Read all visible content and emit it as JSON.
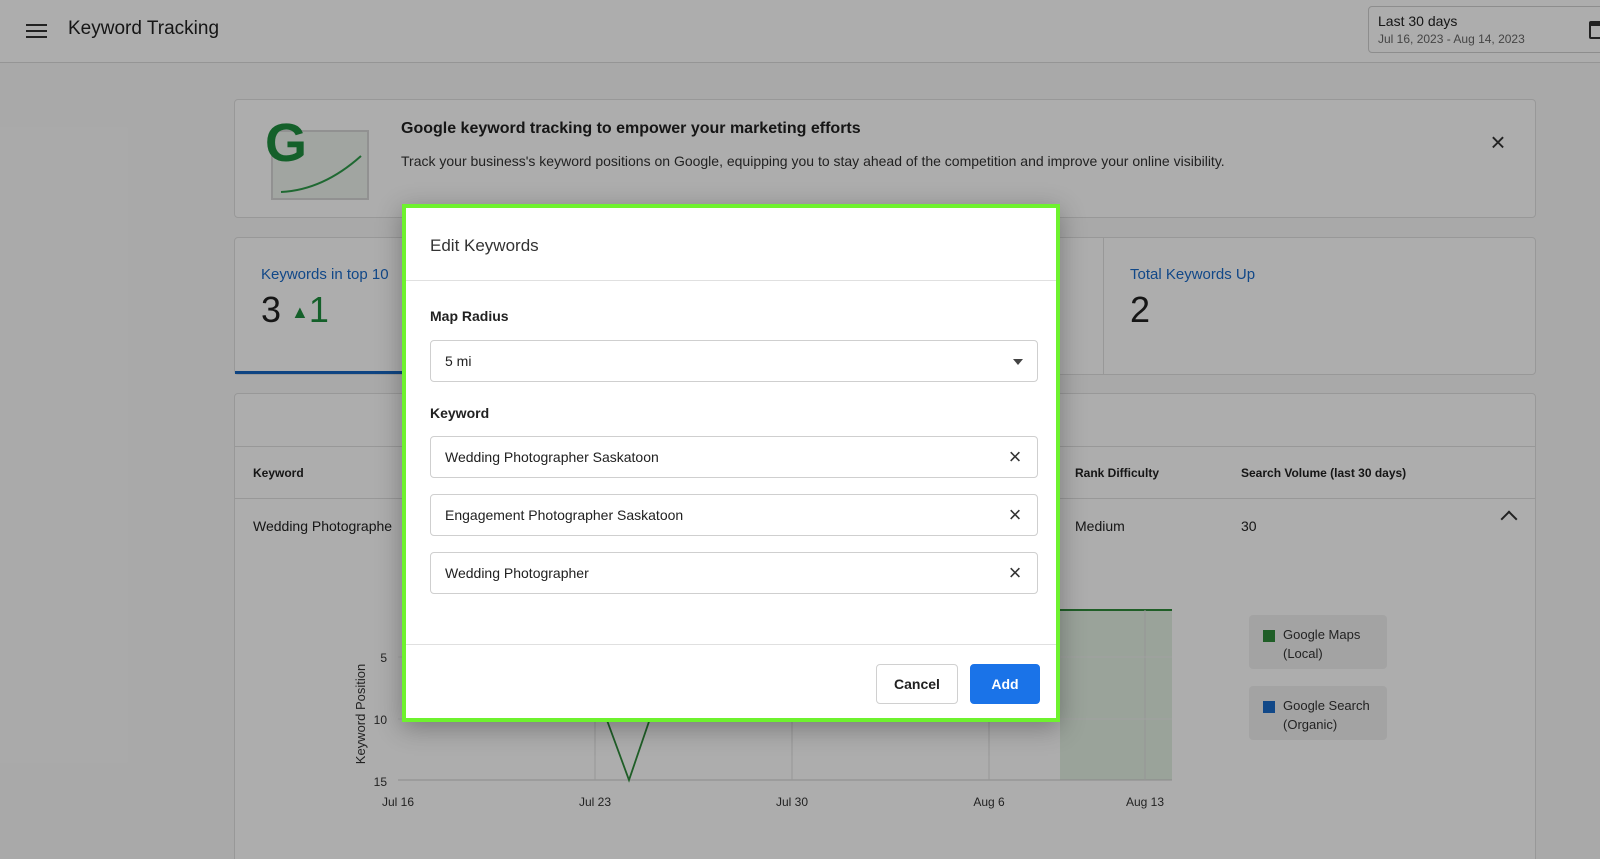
{
  "header": {
    "title": "Keyword Tracking",
    "date_label": "Last 30 days",
    "date_range": "Jul 16, 2023 - Aug 14, 2023"
  },
  "banner": {
    "logo_letter": "G",
    "title": "Google keyword tracking to empower your marketing efforts",
    "text": "Track your business's keyword positions on Google, equipping you to stay ahead of the competition and improve your online visibility."
  },
  "stats": [
    {
      "label": "Keywords in top 10",
      "value": "3",
      "change": "1"
    },
    {
      "label": "Total Keywords Up",
      "value": "2"
    }
  ],
  "table": {
    "columns": [
      "Keyword",
      "Rank Difficulty",
      "Search Volume (last 30 days)"
    ],
    "row": {
      "keyword": "Wedding Photographe",
      "difficulty": "Medium",
      "volume": "30"
    }
  },
  "chart_data": {
    "type": "line",
    "ylabel": "Keyword Position",
    "y_ticks": [
      "5",
      "10",
      "15"
    ],
    "x_ticks": [
      "Jul 16",
      "Jul 23",
      "Jul 30",
      "Aug 6",
      "Aug 13"
    ],
    "ylim": [
      0,
      15
    ],
    "series": [
      {
        "name": "Google Maps (Local)",
        "color": "#2e8b3a"
      },
      {
        "name": "Google Search (Organic)",
        "color": "#1a6ac9"
      }
    ]
  },
  "dialog": {
    "title": "Edit Keywords",
    "map_radius_label": "Map Radius",
    "map_radius_value": "5 mi",
    "keyword_label": "Keyword",
    "keywords": [
      "Wedding Photographer Saskatoon",
      "Engagement Photographer Saskatoon",
      "Wedding Photographer"
    ],
    "cancel_label": "Cancel",
    "add_label": "Add"
  },
  "colors": {
    "accent": "#1a73e8",
    "highlight": "#6ef22e",
    "positive": "#1e8e3e"
  }
}
